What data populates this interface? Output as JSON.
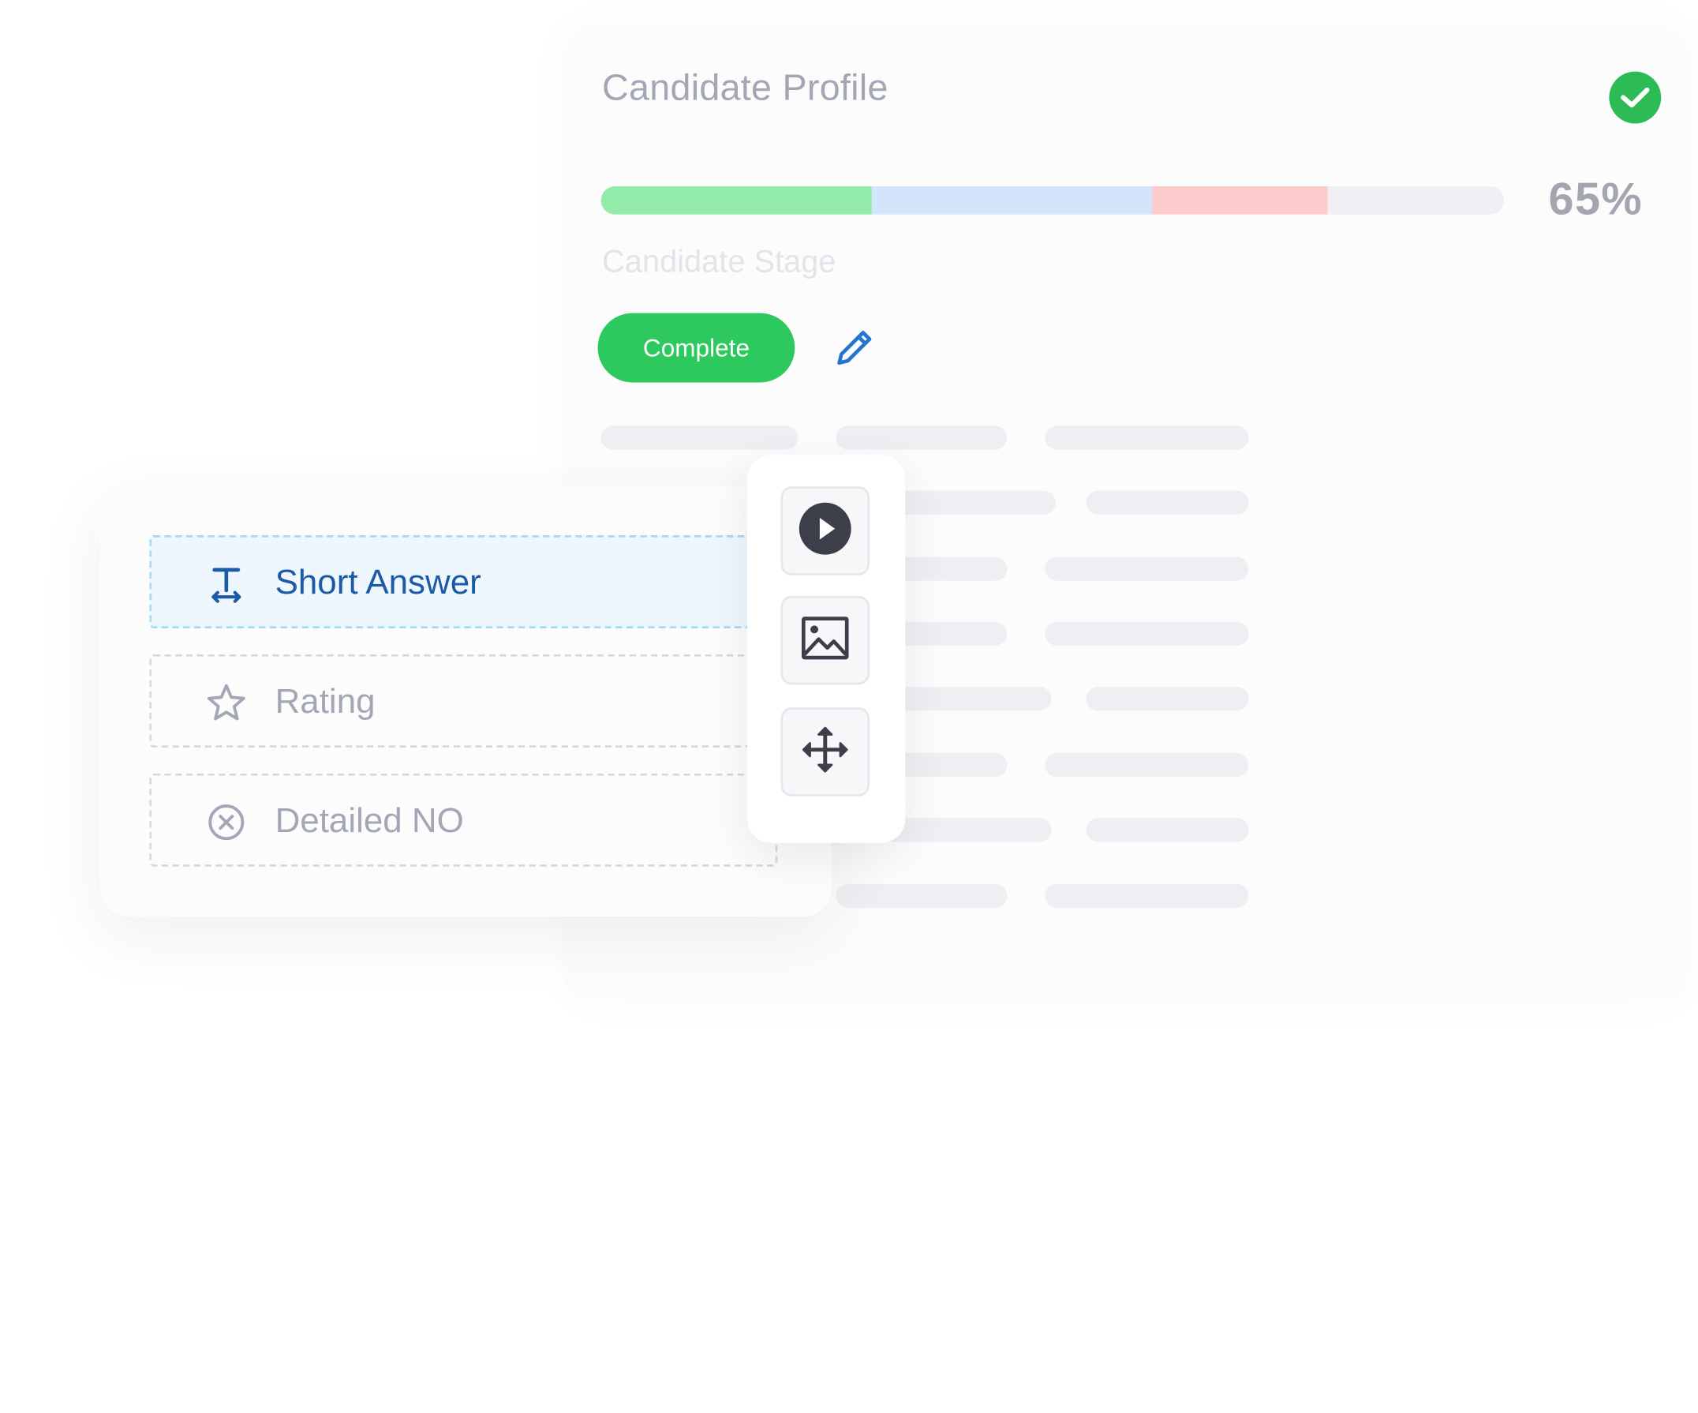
{
  "profile": {
    "title": "Candidate Profile",
    "completed_icon": "check-circle-icon",
    "progress": {
      "percent_label": "65%",
      "segments": [
        {
          "name": "green",
          "fraction": 0.3,
          "color": "#93ebaa"
        },
        {
          "name": "blue",
          "fraction": 0.31,
          "color": "#d2e5fb"
        },
        {
          "name": "red",
          "fraction": 0.195,
          "color": "#fdcbcb"
        }
      ],
      "track_color": "#f0f0f4"
    },
    "stage_label": "Candidate Stage",
    "status_button": "Complete",
    "edit_icon": "pencil-icon"
  },
  "question_types": [
    {
      "label": "Short Answer",
      "icon": "text-cursor-icon",
      "selected": true
    },
    {
      "label": "Rating",
      "icon": "star-icon",
      "selected": false
    },
    {
      "label": "Detailed NO",
      "icon": "x-circle-icon",
      "selected": false
    }
  ],
  "toolbar": {
    "tools": [
      {
        "name": "play",
        "icon": "play-icon"
      },
      {
        "name": "image",
        "icon": "image-icon"
      },
      {
        "name": "move",
        "icon": "move-icon"
      }
    ]
  },
  "colors": {
    "accent_green": "#2ec95e",
    "check_green": "#2dbb55",
    "selected_blue": "#1b5aa6",
    "icon_dark": "#3c3e4a",
    "muted_text": "#a3a6b4"
  }
}
